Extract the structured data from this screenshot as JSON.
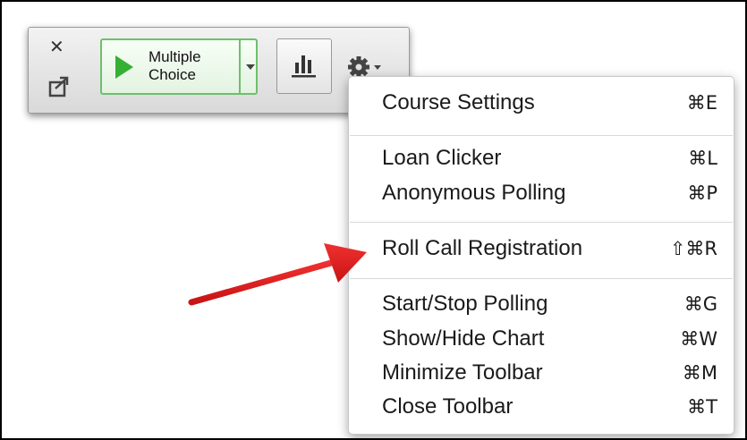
{
  "toolbar": {
    "close_glyph": "✕",
    "multiple_choice_label": "Multiple\nChoice",
    "icons": {
      "close": "close-icon",
      "share": "share-icon",
      "play": "play-icon",
      "dropdown": "chevron-down-icon",
      "chart": "bar-chart-icon",
      "gear": "gear-icon"
    },
    "colors": {
      "play_green": "#35b035",
      "button_border_green": "#6dc06b"
    }
  },
  "menu": {
    "groups": [
      [
        {
          "label": "Course Settings",
          "shortcut": "⌘E"
        }
      ],
      [
        {
          "label": "Loan Clicker",
          "shortcut": "⌘L"
        },
        {
          "label": "Anonymous Polling",
          "shortcut": "⌘P"
        }
      ],
      [
        {
          "label": "Roll Call Registration",
          "shortcut": "⇧⌘R"
        }
      ],
      [
        {
          "label": "Start/Stop Polling",
          "shortcut": "⌘G"
        },
        {
          "label": "Show/Hide Chart",
          "shortcut": "⌘W"
        },
        {
          "label": "Minimize Toolbar",
          "shortcut": "⌘M"
        },
        {
          "label": "Close Toolbar",
          "shortcut": "⌘T"
        }
      ]
    ]
  },
  "annotation": {
    "arrow_color": "#e02020",
    "points_to": "Roll Call Registration"
  }
}
